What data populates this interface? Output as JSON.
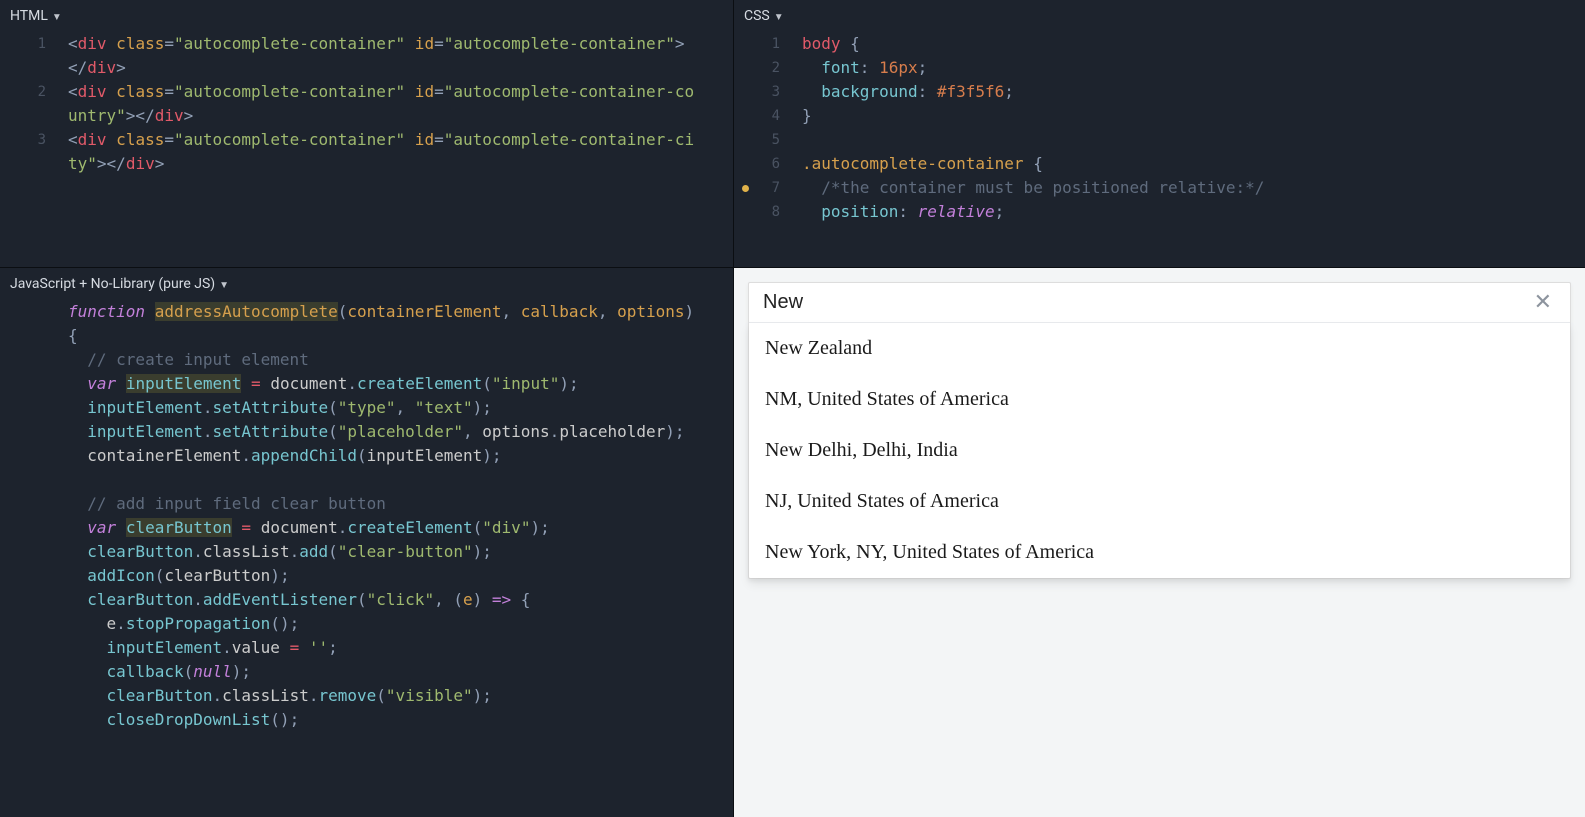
{
  "panels": {
    "html_title": "HTML",
    "css_title": "CSS",
    "js_title": "JavaScript + No-Library (pure JS)"
  },
  "html_code": [
    {
      "n": "1",
      "tokens": [
        {
          "c": "punct",
          "t": "<"
        },
        {
          "c": "tag",
          "t": "div"
        },
        {
          "c": "attr",
          "t": " class"
        },
        {
          "c": "punct",
          "t": "="
        },
        {
          "c": "string",
          "t": "\"autocomplete-container\""
        },
        {
          "c": "attr",
          "t": " id"
        },
        {
          "c": "punct",
          "t": "="
        },
        {
          "c": "string",
          "t": "\"autocomplete-container\""
        },
        {
          "c": "punct",
          "t": "></"
        },
        {
          "c": "tag",
          "t": "div"
        },
        {
          "c": "punct",
          "t": ">"
        }
      ]
    },
    {
      "n": "2",
      "tokens": [
        {
          "c": "punct",
          "t": "<"
        },
        {
          "c": "tag",
          "t": "div"
        },
        {
          "c": "attr",
          "t": " class"
        },
        {
          "c": "punct",
          "t": "="
        },
        {
          "c": "string",
          "t": "\"autocomplete-container\""
        },
        {
          "c": "attr",
          "t": " id"
        },
        {
          "c": "punct",
          "t": "="
        },
        {
          "c": "string",
          "t": "\"autocomplete-container-country\""
        },
        {
          "c": "punct",
          "t": "></"
        },
        {
          "c": "tag",
          "t": "div"
        },
        {
          "c": "punct",
          "t": ">"
        }
      ]
    },
    {
      "n": "3",
      "tokens": [
        {
          "c": "punct",
          "t": "<"
        },
        {
          "c": "tag",
          "t": "div"
        },
        {
          "c": "attr",
          "t": " class"
        },
        {
          "c": "punct",
          "t": "="
        },
        {
          "c": "string",
          "t": "\"autocomplete-container\""
        },
        {
          "c": "attr",
          "t": " id"
        },
        {
          "c": "punct",
          "t": "="
        },
        {
          "c": "string",
          "t": "\"autocomplete-container-city\""
        },
        {
          "c": "punct",
          "t": "></"
        },
        {
          "c": "tag",
          "t": "div"
        },
        {
          "c": "punct",
          "t": ">"
        }
      ]
    }
  ],
  "css_code": [
    {
      "n": "1",
      "dot": false,
      "tokens": [
        {
          "c": "tag",
          "t": "body"
        },
        {
          "c": "ident",
          "t": " "
        },
        {
          "c": "punct",
          "t": "{"
        }
      ]
    },
    {
      "n": "2",
      "dot": false,
      "tokens": [
        {
          "c": "ident",
          "t": "  "
        },
        {
          "c": "prop",
          "t": "font"
        },
        {
          "c": "punct",
          "t": ": "
        },
        {
          "c": "num",
          "t": "16px"
        },
        {
          "c": "punct",
          "t": ";"
        }
      ]
    },
    {
      "n": "3",
      "dot": false,
      "tokens": [
        {
          "c": "ident",
          "t": "  "
        },
        {
          "c": "prop",
          "t": "background"
        },
        {
          "c": "punct",
          "t": ": "
        },
        {
          "c": "num",
          "t": "#f3f5f6"
        },
        {
          "c": "punct",
          "t": ";"
        }
      ]
    },
    {
      "n": "4",
      "dot": false,
      "tokens": [
        {
          "c": "punct",
          "t": "}"
        }
      ]
    },
    {
      "n": "5",
      "dot": false,
      "tokens": [
        {
          "c": "ident",
          "t": " "
        }
      ]
    },
    {
      "n": "6",
      "dot": false,
      "tokens": [
        {
          "c": "sel",
          "t": ".autocomplete-container"
        },
        {
          "c": "ident",
          "t": " "
        },
        {
          "c": "punct",
          "t": "{"
        }
      ]
    },
    {
      "n": "7",
      "dot": true,
      "tokens": [
        {
          "c": "ident",
          "t": "  "
        },
        {
          "c": "comment",
          "t": "/*the container must be positioned relative:*/"
        }
      ]
    },
    {
      "n": "8",
      "dot": false,
      "tokens": [
        {
          "c": "ident",
          "t": "  "
        },
        {
          "c": "prop",
          "t": "position"
        },
        {
          "c": "punct",
          "t": ": "
        },
        {
          "c": "kw",
          "t": "relative"
        },
        {
          "c": "punct",
          "t": ";"
        }
      ]
    }
  ],
  "js_code": [
    {
      "n": "",
      "indent": 0,
      "tokens": [
        {
          "c": "kw",
          "t": "function"
        },
        {
          "c": "ident",
          "t": " "
        },
        {
          "c": "fnname hl",
          "t": "addressAutocomplete"
        },
        {
          "c": "punct",
          "t": "("
        },
        {
          "c": "par",
          "t": "containerElement"
        },
        {
          "c": "punct",
          "t": ", "
        },
        {
          "c": "par",
          "t": "callback"
        },
        {
          "c": "punct",
          "t": ", "
        },
        {
          "c": "par",
          "t": "options"
        },
        {
          "c": "punct",
          "t": ") {"
        }
      ]
    },
    {
      "n": "",
      "indent": 1,
      "tokens": [
        {
          "c": "comment",
          "t": "// create input element"
        }
      ]
    },
    {
      "n": "",
      "indent": 1,
      "tokens": [
        {
          "c": "kw",
          "t": "var"
        },
        {
          "c": "ident",
          "t": " "
        },
        {
          "c": "var hl",
          "t": "inputElement"
        },
        {
          "c": "ident",
          "t": " "
        },
        {
          "c": "op",
          "t": "="
        },
        {
          "c": "ident",
          "t": " document"
        },
        {
          "c": "punct",
          "t": "."
        },
        {
          "c": "fn",
          "t": "createElement"
        },
        {
          "c": "punct",
          "t": "("
        },
        {
          "c": "string",
          "t": "\"input\""
        },
        {
          "c": "punct",
          "t": ");"
        }
      ]
    },
    {
      "n": "",
      "indent": 1,
      "tokens": [
        {
          "c": "var",
          "t": "inputElement"
        },
        {
          "c": "punct",
          "t": "."
        },
        {
          "c": "fn",
          "t": "setAttribute"
        },
        {
          "c": "punct",
          "t": "("
        },
        {
          "c": "string",
          "t": "\"type\""
        },
        {
          "c": "punct",
          "t": ", "
        },
        {
          "c": "string",
          "t": "\"text\""
        },
        {
          "c": "punct",
          "t": ");"
        }
      ]
    },
    {
      "n": "",
      "indent": 1,
      "tokens": [
        {
          "c": "var",
          "t": "inputElement"
        },
        {
          "c": "punct",
          "t": "."
        },
        {
          "c": "fn",
          "t": "setAttribute"
        },
        {
          "c": "punct",
          "t": "("
        },
        {
          "c": "string",
          "t": "\"placeholder\""
        },
        {
          "c": "punct",
          "t": ", "
        },
        {
          "c": "ident",
          "t": "options"
        },
        {
          "c": "punct",
          "t": "."
        },
        {
          "c": "ident",
          "t": "placeholder"
        },
        {
          "c": "punct",
          "t": ");"
        }
      ]
    },
    {
      "n": "",
      "indent": 1,
      "tokens": [
        {
          "c": "ident",
          "t": "containerElement"
        },
        {
          "c": "punct",
          "t": "."
        },
        {
          "c": "fn",
          "t": "appendChild"
        },
        {
          "c": "punct",
          "t": "("
        },
        {
          "c": "ident",
          "t": "inputElement"
        },
        {
          "c": "punct",
          "t": ");"
        }
      ]
    },
    {
      "n": "",
      "indent": 0,
      "tokens": [
        {
          "c": "ident",
          "t": " "
        }
      ]
    },
    {
      "n": "",
      "indent": 1,
      "tokens": [
        {
          "c": "comment",
          "t": "// add input field clear button"
        }
      ]
    },
    {
      "n": "",
      "indent": 1,
      "tokens": [
        {
          "c": "kw",
          "t": "var"
        },
        {
          "c": "ident",
          "t": " "
        },
        {
          "c": "var hl",
          "t": "clearButton"
        },
        {
          "c": "ident",
          "t": " "
        },
        {
          "c": "op",
          "t": "="
        },
        {
          "c": "ident",
          "t": " document"
        },
        {
          "c": "punct",
          "t": "."
        },
        {
          "c": "fn",
          "t": "createElement"
        },
        {
          "c": "punct",
          "t": "("
        },
        {
          "c": "string",
          "t": "\"div\""
        },
        {
          "c": "punct",
          "t": ");"
        }
      ]
    },
    {
      "n": "",
      "indent": 1,
      "tokens": [
        {
          "c": "var",
          "t": "clearButton"
        },
        {
          "c": "punct",
          "t": "."
        },
        {
          "c": "ident",
          "t": "classList"
        },
        {
          "c": "punct",
          "t": "."
        },
        {
          "c": "fn",
          "t": "add"
        },
        {
          "c": "punct",
          "t": "("
        },
        {
          "c": "string",
          "t": "\"clear-button\""
        },
        {
          "c": "punct",
          "t": ");"
        }
      ]
    },
    {
      "n": "",
      "indent": 1,
      "tokens": [
        {
          "c": "fn",
          "t": "addIcon"
        },
        {
          "c": "punct",
          "t": "("
        },
        {
          "c": "ident",
          "t": "clearButton"
        },
        {
          "c": "punct",
          "t": ");"
        }
      ]
    },
    {
      "n": "",
      "indent": 1,
      "tokens": [
        {
          "c": "var",
          "t": "clearButton"
        },
        {
          "c": "punct",
          "t": "."
        },
        {
          "c": "fn",
          "t": "addEventListener"
        },
        {
          "c": "punct",
          "t": "("
        },
        {
          "c": "string",
          "t": "\"click\""
        },
        {
          "c": "punct",
          "t": ", ("
        },
        {
          "c": "par",
          "t": "e"
        },
        {
          "c": "punct",
          "t": ") "
        },
        {
          "c": "kw",
          "t": "=>"
        },
        {
          "c": "punct",
          "t": " {"
        }
      ]
    },
    {
      "n": "",
      "indent": 2,
      "tokens": [
        {
          "c": "ident",
          "t": "e"
        },
        {
          "c": "punct",
          "t": "."
        },
        {
          "c": "fn",
          "t": "stopPropagation"
        },
        {
          "c": "punct",
          "t": "();"
        }
      ]
    },
    {
      "n": "",
      "indent": 2,
      "tokens": [
        {
          "c": "var",
          "t": "inputElement"
        },
        {
          "c": "punct",
          "t": "."
        },
        {
          "c": "ident",
          "t": "value"
        },
        {
          "c": "ident",
          "t": " "
        },
        {
          "c": "op",
          "t": "="
        },
        {
          "c": "ident",
          "t": " "
        },
        {
          "c": "string",
          "t": "''"
        },
        {
          "c": "punct",
          "t": ";"
        }
      ]
    },
    {
      "n": "",
      "indent": 2,
      "tokens": [
        {
          "c": "fn",
          "t": "callback"
        },
        {
          "c": "punct",
          "t": "("
        },
        {
          "c": "kw",
          "t": "null"
        },
        {
          "c": "punct",
          "t": ");"
        }
      ]
    },
    {
      "n": "",
      "indent": 2,
      "tokens": [
        {
          "c": "var",
          "t": "clearButton"
        },
        {
          "c": "punct",
          "t": "."
        },
        {
          "c": "ident",
          "t": "classList"
        },
        {
          "c": "punct",
          "t": "."
        },
        {
          "c": "fn",
          "t": "remove"
        },
        {
          "c": "punct",
          "t": "("
        },
        {
          "c": "string",
          "t": "\"visible\""
        },
        {
          "c": "punct",
          "t": ");"
        }
      ]
    },
    {
      "n": "",
      "indent": 2,
      "tokens": [
        {
          "c": "fn",
          "t": "closeDropDownList"
        },
        {
          "c": "punct",
          "t": "();"
        }
      ]
    }
  ],
  "result": {
    "input_value": "New",
    "suggestions": [
      "New Zealand",
      "NM, United States of America",
      "New Delhi, Delhi, India",
      "NJ, United States of America",
      "New York, NY, United States of America"
    ]
  }
}
